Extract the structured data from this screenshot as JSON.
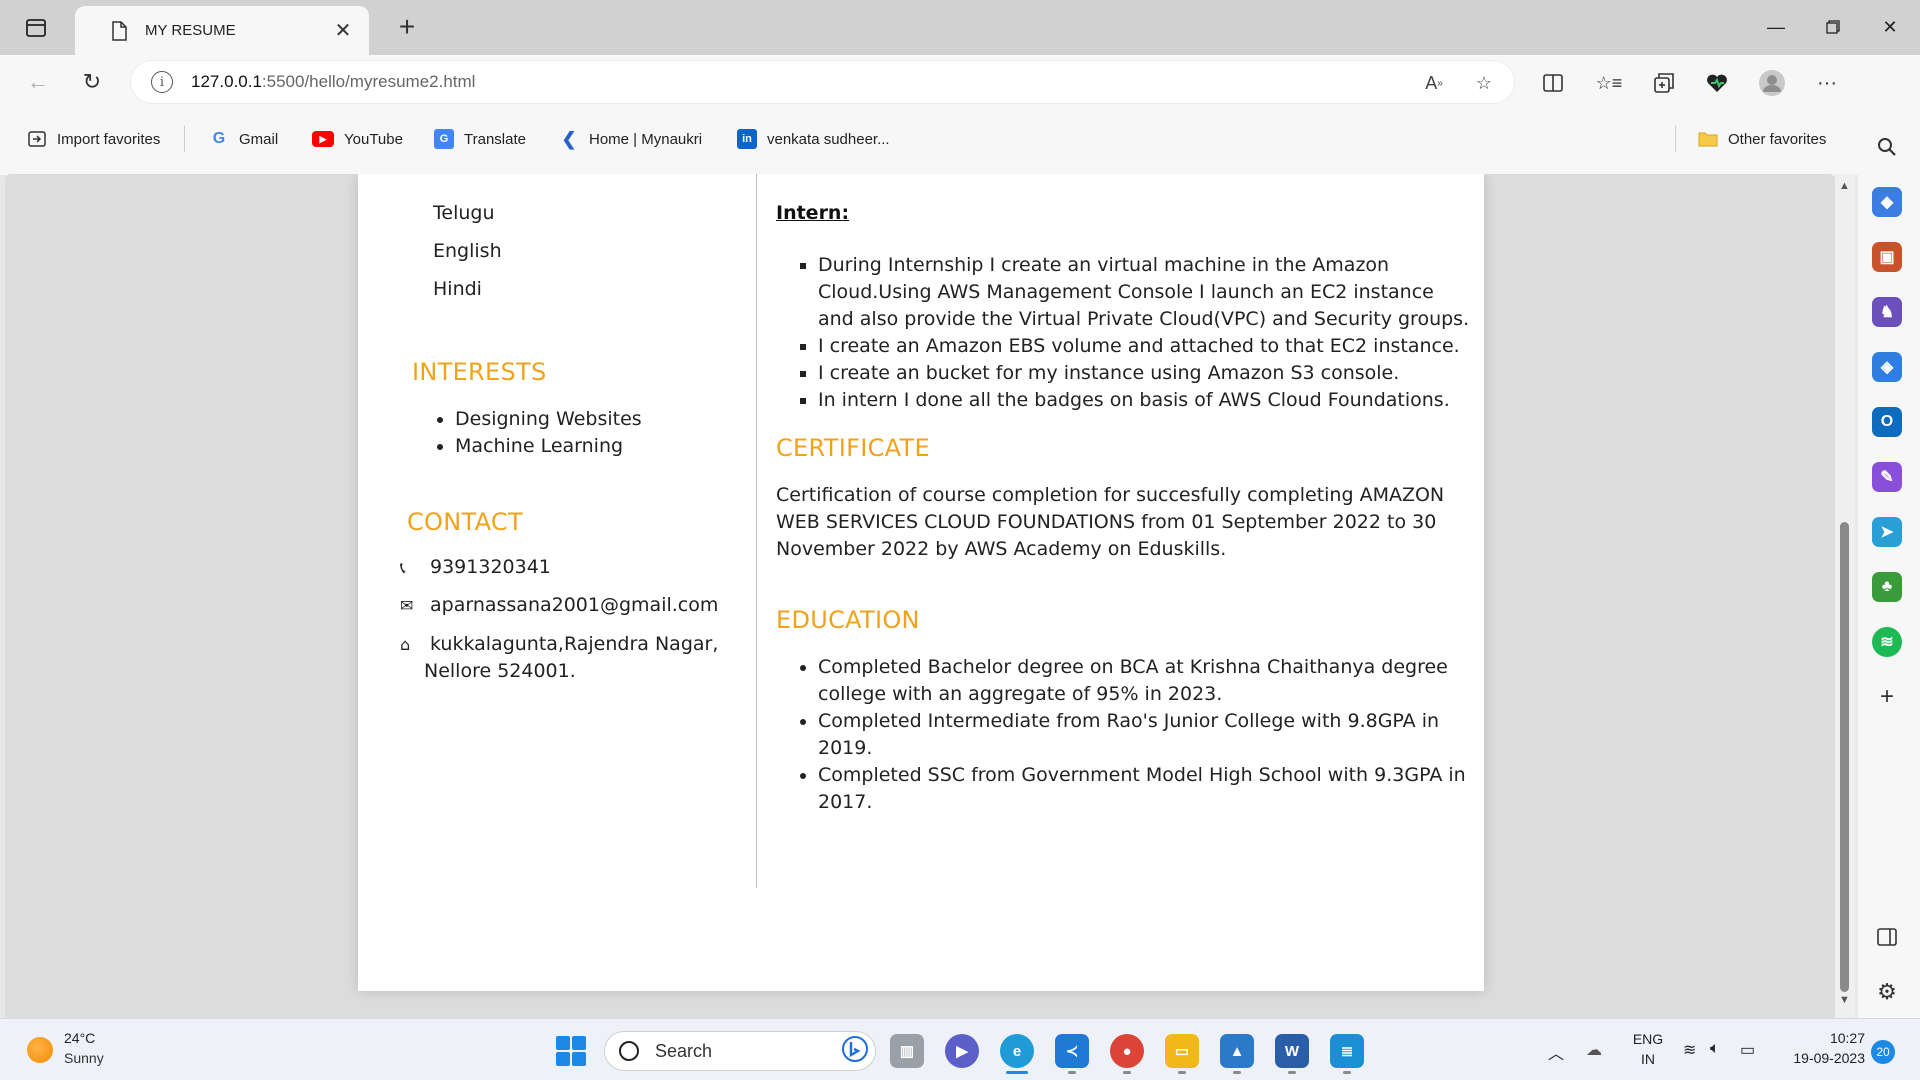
{
  "browser": {
    "tab_title": "MY RESUME",
    "url_host": "127.0.0.1",
    "url_path": ":5500/hello/myresume2.html",
    "favorites": [
      {
        "label": "Import favorites",
        "icon": "import-icon"
      },
      {
        "label": "Gmail",
        "icon": "google-icon"
      },
      {
        "label": "YouTube",
        "icon": "youtube-icon"
      },
      {
        "label": "Translate",
        "icon": "translate-icon"
      },
      {
        "label": "Home | Mynaukri",
        "icon": "mynaukri-icon"
      },
      {
        "label": "venkata sudheer...",
        "icon": "linkedin-icon"
      }
    ],
    "other_favorites": "Other favorites"
  },
  "resume": {
    "languages": [
      "Telugu",
      "English",
      "Hindi"
    ],
    "interests_heading": "INTERESTS",
    "interests": [
      "Designing Websites",
      "Machine Learning"
    ],
    "contact_heading": "CONTACT",
    "phone": "9391320341",
    "email": "aparnassana2001@gmail.com",
    "address_line1": "kukkalagunta,Rajendra Nagar,",
    "address_line2": "Nellore 524001.",
    "intern_heading": "Intern:",
    "intern_points": [
      "During Internship I create an virtual machine in the Amazon Cloud.Using AWS Management Console I launch an EC2 instance and also provide the Virtual Private Cloud(VPC) and Security groups.",
      "I create an Amazon EBS volume and attached to that EC2 instance.",
      "I create an bucket for my instance using Amazon S3 console.",
      "In intern I done all the badges on basis of AWS Cloud Foundations."
    ],
    "certificate_heading": "CERTIFICATE",
    "certificate_text": "Certification of course completion for succesfully completing AMAZON WEB SERVICES CLOUD FOUNDATIONS from 01 September 2022 to 30 November 2022 by AWS Academy on Eduskills.",
    "education_heading": "EDUCATION",
    "education_points": [
      "Completed Bachelor degree on BCA at Krishna Chaithanya degree college with an aggregate of 95% in 2023.",
      "Completed Intermediate from Rao's Junior College with 9.8GPA in 2019.",
      "Completed SSC from Government Model High School with 9.3GPA in 2017."
    ]
  },
  "taskbar": {
    "temperature": "24°C",
    "weather": "Sunny",
    "search_placeholder": "Search",
    "lang_top": "ENG",
    "lang_bottom": "IN",
    "time": "10:27",
    "date": "19-09-2023",
    "notification_count": "20"
  },
  "colors": {
    "heading_accent": "#f0a318",
    "windows_blue": "#1e88e5"
  }
}
